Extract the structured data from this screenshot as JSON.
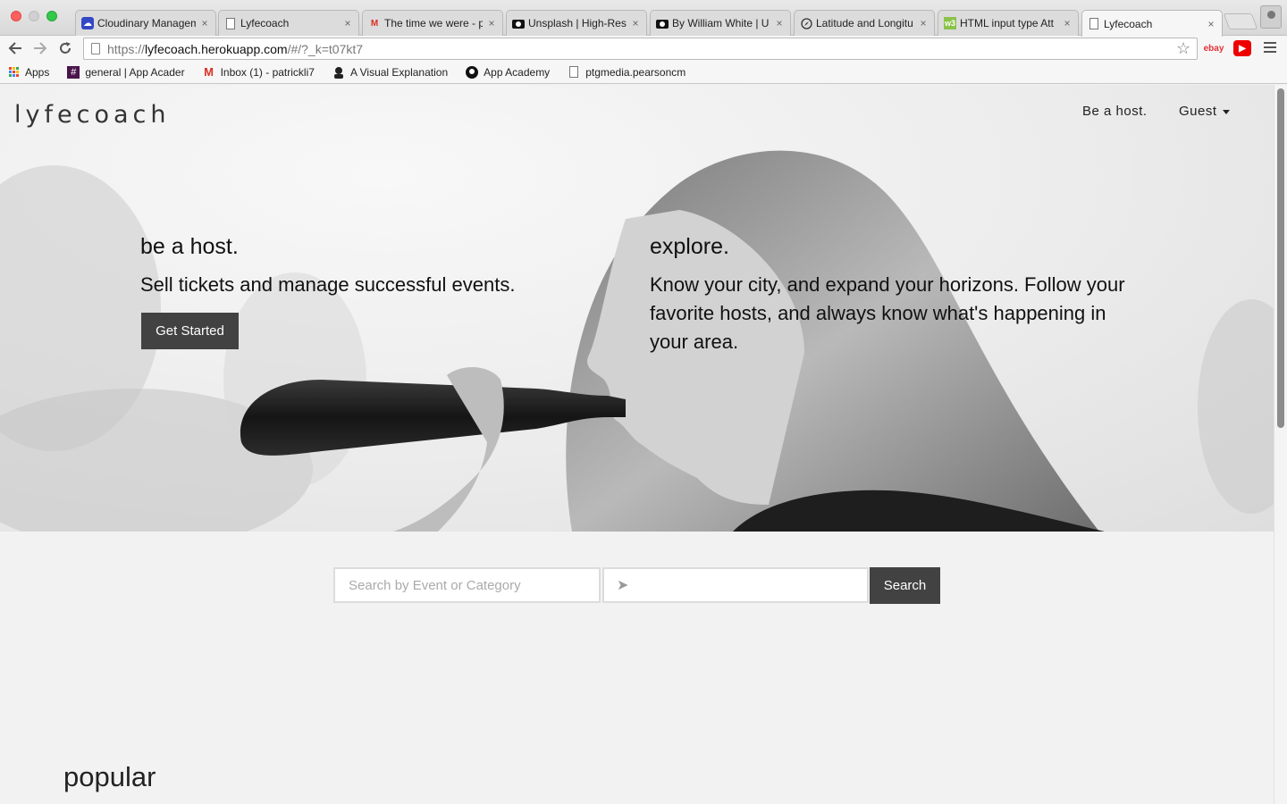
{
  "browser": {
    "tabs": [
      {
        "title": "Cloudinary Managem",
        "icon": "cloudinary-icon",
        "active": false
      },
      {
        "title": "Lyfecoach",
        "icon": "page-icon",
        "active": false
      },
      {
        "title": "The time we were - p",
        "icon": "gmail-icon",
        "active": false
      },
      {
        "title": "Unsplash | High-Res",
        "icon": "camera-icon",
        "active": false
      },
      {
        "title": "By William White | U",
        "icon": "camera-icon",
        "active": false
      },
      {
        "title": "Latitude and Longitu",
        "icon": "compass-icon",
        "active": false
      },
      {
        "title": "HTML input type Att",
        "icon": "w3schools-icon",
        "active": false
      },
      {
        "title": "Lyfecoach",
        "icon": "page-icon",
        "active": true
      }
    ],
    "close_glyph": "×",
    "url": {
      "scheme": "https://",
      "host": "lyfecoach.herokuapp.com",
      "path": "/#/?_k=t07kt7"
    },
    "extensions": {
      "ebay": "ebay",
      "youtube": "▶"
    },
    "bookmarks": [
      {
        "label": "Apps",
        "icon": "apps-grid-icon"
      },
      {
        "label": "general | App Acader",
        "icon": "slack-icon"
      },
      {
        "label": "Inbox (1) - patrickli7",
        "icon": "gmail-icon"
      },
      {
        "label": "A Visual Explanation",
        "icon": "avatar-icon"
      },
      {
        "label": "App Academy",
        "icon": "github-icon"
      },
      {
        "label": "ptgmedia.pearsoncm",
        "icon": "page-icon"
      }
    ]
  },
  "header": {
    "logo": "lyfecoach",
    "nav_host": "Be a host.",
    "nav_guest": "Guest"
  },
  "hero": {
    "host_title": "be a host.",
    "host_text": "Sell tickets and manage successful events.",
    "cta_label": "Get Started",
    "explore_title": "explore.",
    "explore_text": "Know your city, and expand your horizons. Follow your favorite hosts, and always know what's happening in your area."
  },
  "search": {
    "query_placeholder": "Search by Event or Category",
    "location_glyph": "➤",
    "button_label": "Search"
  },
  "sections": {
    "popular_title": "popular"
  },
  "colors": {
    "button_bg": "#424242",
    "page_bg": "#f2f2f2"
  }
}
